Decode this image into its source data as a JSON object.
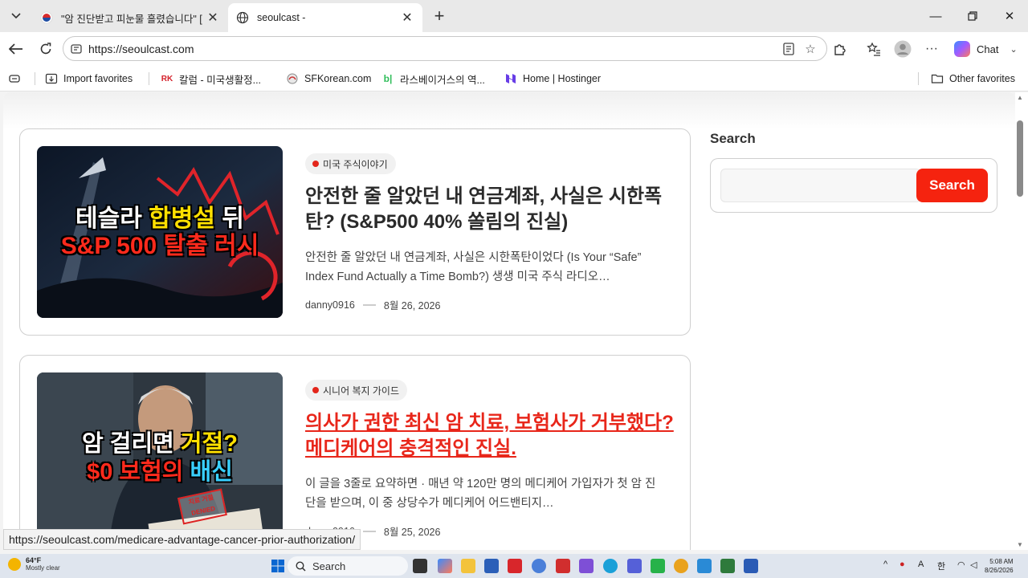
{
  "browser": {
    "tabs": [
      {
        "title": "\"암 진단받고 피눈물 흘렸습니다\" [",
        "active": false
      },
      {
        "title": "seoulcast -",
        "active": true
      }
    ],
    "url": "https://seoulcast.com",
    "chat_label": "Chat",
    "favorites": [
      {
        "label": "Import favorites",
        "icon": "import-icon"
      },
      {
        "label": "칼럼 - 미국생활정...",
        "icon": "rk-logo-icon"
      },
      {
        "label": "SFKorean.com",
        "icon": "sfkorean-icon"
      },
      {
        "label": "라스베이거스의 역...",
        "icon": "bl-logo-icon"
      },
      {
        "label": "Home | Hostinger",
        "icon": "hostinger-icon"
      },
      {
        "label": "Other favorites",
        "icon": "folder-icon"
      }
    ]
  },
  "posts": [
    {
      "category": "미국 주식이야기",
      "title": "안전한 줄 알았던 내 연금계좌, 사실은 시한폭탄? (S&P500 40% 쏠림의 진실)",
      "excerpt": "안전한 줄 알았던 내 연금계좌, 사실은 시한폭탄이었다 (Is Your “Safe” Index Fund Actually a Time Bomb?) 생생 미국 주식 라디오…",
      "author": "danny0916",
      "date": "8월 26, 2026",
      "thumb_line1a": "테슬라 ",
      "thumb_line1b": "합병설",
      "thumb_line1c": " 뒤",
      "thumb_line2": "S&P 500 탈출 러시"
    },
    {
      "category": "시니어 복지 가이드",
      "title": "의사가 권한 최신 암 치료, 보험사가 거부했다? 메디케어의 충격적인 진실.",
      "excerpt": "이 글을 3줄로 요약하면 · 매년 약 120만 명의 메디케어 가입자가 첫 암 진단을 받으며, 이 중 상당수가 메디케어 어드밴티지…",
      "author": "danny0916",
      "date": "8월 25, 2026",
      "thumb_line1a": "암 걸리면 ",
      "thumb_line1b": "거절?",
      "thumb_line2a": "$0 보험의 ",
      "thumb_line2b": "배신",
      "stamp_line1": "치료 거절",
      "stamp_line2": "DENIED"
    }
  ],
  "sidebar": {
    "search_title": "Search",
    "search_button": "Search"
  },
  "status_url": "https://seoulcast.com/medicare-advantage-cancer-prior-authorization/",
  "taskbar": {
    "temp": "64°F",
    "condition": "Mostly clear",
    "search_label": "Search",
    "time": "5:08 AM",
    "date": "8/26/2026",
    "ime_a": "A",
    "ime_han": "한"
  },
  "colors": {
    "accent": "#f5230f",
    "category_dot": "#e3261b"
  }
}
